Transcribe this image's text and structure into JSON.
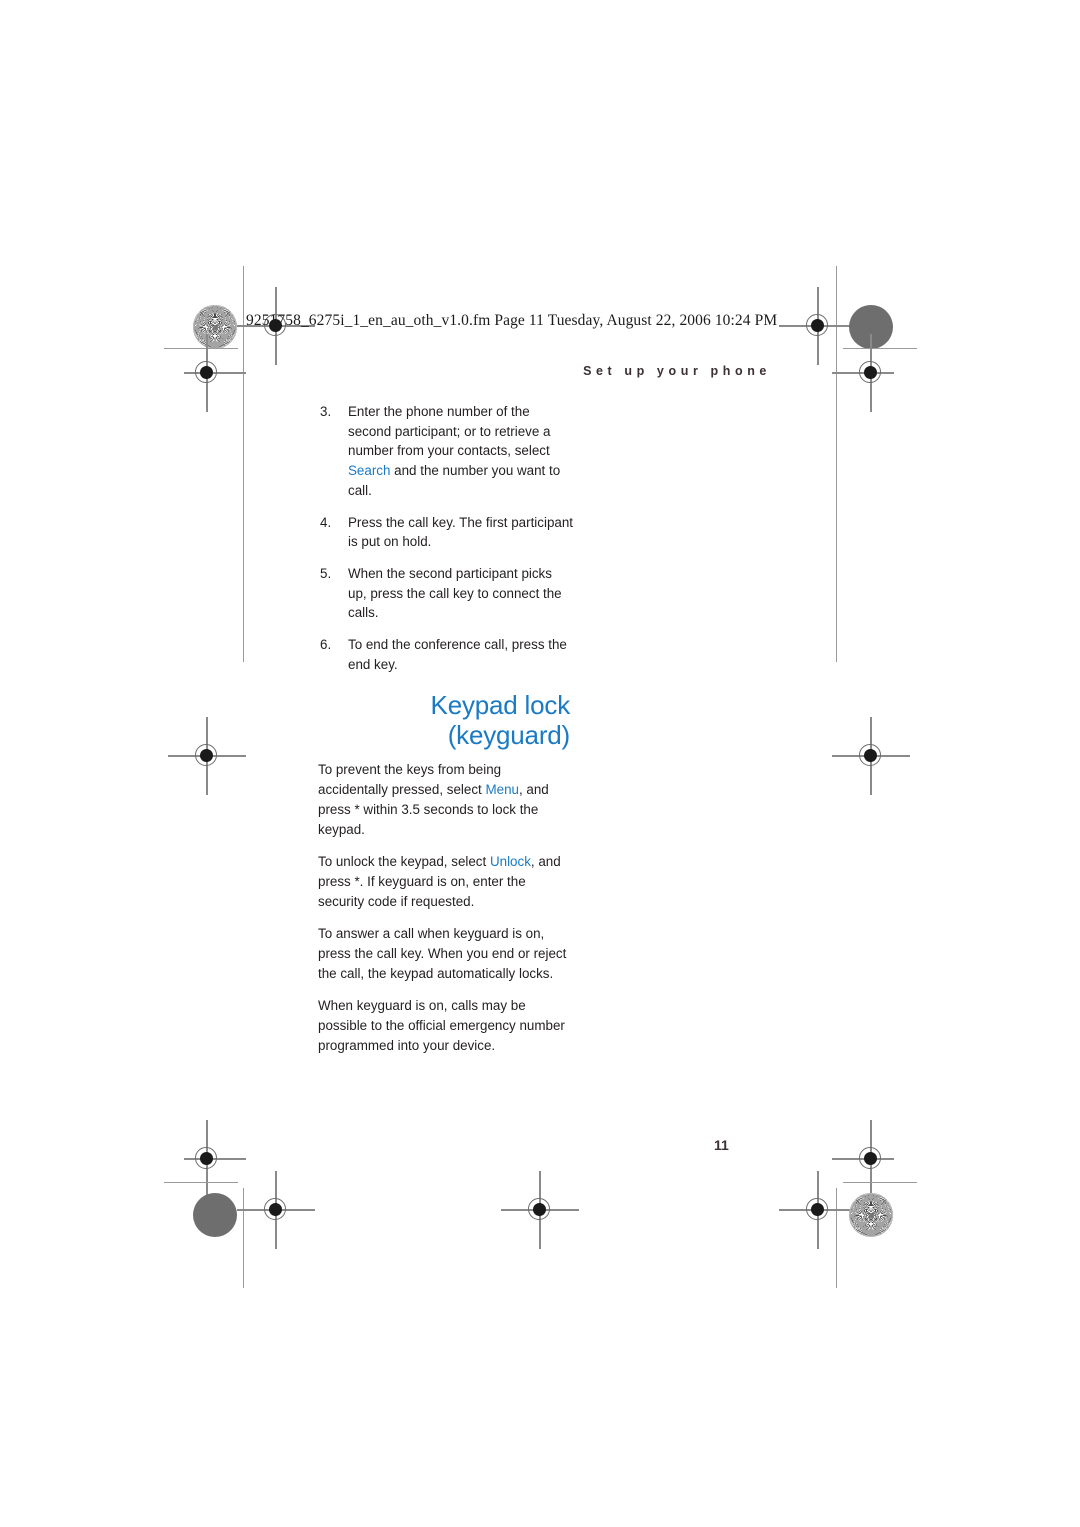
{
  "page": {
    "file_stamp": "9251758_6275i_1_en_au_oth_v1.0.fm  Page 11  Tuesday, August 22, 2006  10:24 PM",
    "running_head": "Set up your phone",
    "page_number": "11",
    "accent_color": "#1a7ac4",
    "text_color": "#231f20"
  },
  "steps": [
    {
      "number": "3.",
      "before": "Enter the phone number of the second participant; or to retrieve a number from your contacts, select ",
      "ui": "Search",
      "after": " and the number you want to call."
    },
    {
      "number": "4.",
      "before": "Press the call key. The first participant is put on hold.",
      "ui": "",
      "after": ""
    },
    {
      "number": "5.",
      "before": "When the second participant picks up, press the call key to connect the calls.",
      "ui": "",
      "after": ""
    },
    {
      "number": "6.",
      "before": "To end the conference call, press the end key.",
      "ui": "",
      "after": ""
    }
  ],
  "section": {
    "title": "Keypad lock (keyguard)",
    "paragraphs": [
      {
        "before": "To prevent the keys from being accidentally pressed, select ",
        "ui": "Menu",
        "after": ", and press * within 3.5 seconds to lock the keypad."
      },
      {
        "before": "To unlock the keypad, select ",
        "ui": "Unlock",
        "after": ", and press *. If keyguard is on, enter the security code if requested."
      },
      {
        "before": "To answer a call when keyguard is on, press the call key. When you end or reject the call, the keypad automatically locks.",
        "ui": "",
        "after": ""
      },
      {
        "before": "When keyguard is on, calls may be possible to the official emergency number programmed into your device.",
        "ui": "",
        "after": ""
      }
    ]
  },
  "print_marks": {
    "registration_icon": "registration-target-icon",
    "starburst_icon": "starburst-density-icon",
    "solid_icon": "solid-density-patch-icon"
  }
}
